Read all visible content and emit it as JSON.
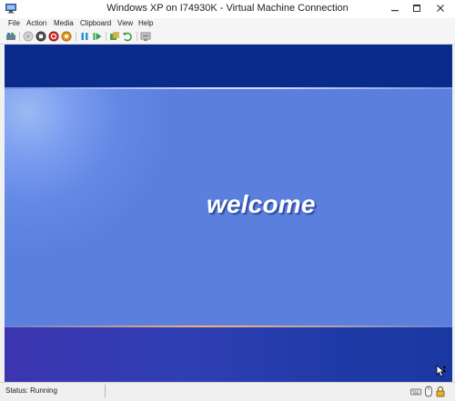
{
  "window": {
    "title": "Windows XP on I74930K - Virtual Machine Connection"
  },
  "menu": {
    "items": [
      "File",
      "Action",
      "Media",
      "Clipboard",
      "View",
      "Help"
    ]
  },
  "toolbar": {
    "icons": [
      "ctrl-alt-del-icon",
      "start-icon",
      "turn-off-icon",
      "shut-down-icon",
      "save-icon",
      "pause-icon",
      "reset-icon",
      "snapshot-icon",
      "revert-icon",
      "enhanced-session-icon"
    ]
  },
  "vm_screen": {
    "welcome_text": "welcome",
    "colors": {
      "top_band": "#0a2b8c",
      "panel": "#5a7fdc",
      "bottom_band": "#3c35b0"
    }
  },
  "status": {
    "text": "Status: Running"
  }
}
